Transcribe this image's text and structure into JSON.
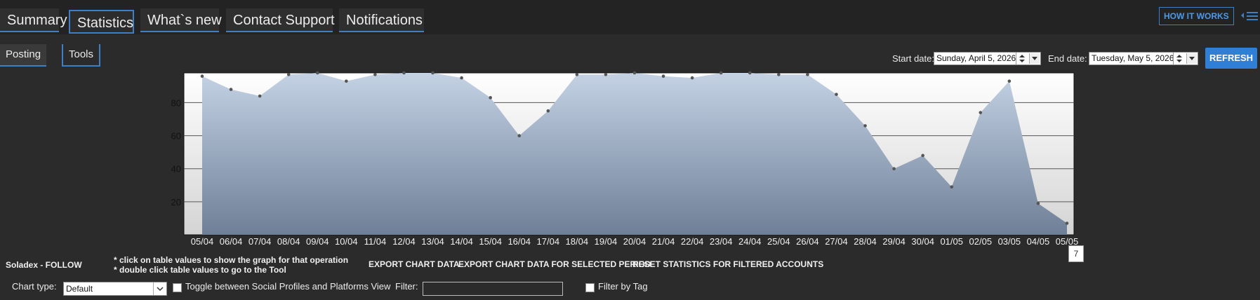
{
  "tabs": [
    {
      "label": "Summary",
      "active": false
    },
    {
      "label": "Statistics",
      "active": true
    },
    {
      "label": "What`s new",
      "active": false
    },
    {
      "label": "Contact Support",
      "active": false
    },
    {
      "label": "Notifications",
      "active": false
    }
  ],
  "how_it_works": "HOW IT WORKS",
  "subtabs": {
    "posting": "Posting",
    "tools": "Tools"
  },
  "dates": {
    "start_label": "Start date:",
    "start_value": "Sunday, April 5, 2026",
    "end_label": "End date:",
    "end_value": "Tuesday, May 5, 2026"
  },
  "refresh_label": "REFRESH",
  "tooltip_value": "7",
  "chart_data": {
    "type": "area",
    "categories": [
      "05/04",
      "06/04",
      "07/04",
      "08/04",
      "09/04",
      "10/04",
      "11/04",
      "12/04",
      "13/04",
      "14/04",
      "15/04",
      "16/04",
      "17/04",
      "18/04",
      "19/04",
      "20/04",
      "21/04",
      "22/04",
      "23/04",
      "24/04",
      "25/04",
      "26/04",
      "27/04",
      "28/04",
      "29/04",
      "30/04",
      "01/05",
      "02/05",
      "03/05",
      "04/05",
      "05/05"
    ],
    "values": [
      96,
      88,
      84,
      97,
      98,
      93,
      97,
      98,
      98,
      95,
      83,
      60,
      75,
      97,
      97,
      98,
      96,
      95,
      98,
      98,
      97,
      97,
      85,
      66,
      40,
      48,
      29,
      74,
      93,
      19,
      7
    ],
    "yticks": [
      20,
      40,
      60,
      80
    ],
    "ylim": [
      0,
      98
    ],
    "grid": true,
    "colors": {
      "fill_top": "#c4d2e4",
      "fill_bottom": "#6e7f97",
      "plot_bg_top": "#ffffff",
      "plot_bg_bottom": "#d4d4d4",
      "marker": "#555555"
    }
  },
  "footer": {
    "title": "Soladex - FOLLOW",
    "hint1": "* click on table values to show the graph for that operation",
    "hint2": "* double click table values to go to the Tool",
    "export_chart": "EXPORT CHART DATA",
    "export_period": "EXPORT CHART DATA FOR SELECTED PERIOD",
    "reset_stats": "RESET STATISTICS FOR FILTERED ACCOUNTS",
    "chart_type_label": "Chart type:",
    "chart_type_value": "Default",
    "toggle_label": "Toggle between Social Profiles and Platforms View",
    "filter_label": "Filter:",
    "filter_value": "",
    "filter_tag_label": "Filter by Tag"
  },
  "icons": {
    "menu": "hamburger-menu-icon",
    "spinner": "spinner-arrows-icon",
    "dropdown": "dropdown-arrow-icon"
  }
}
